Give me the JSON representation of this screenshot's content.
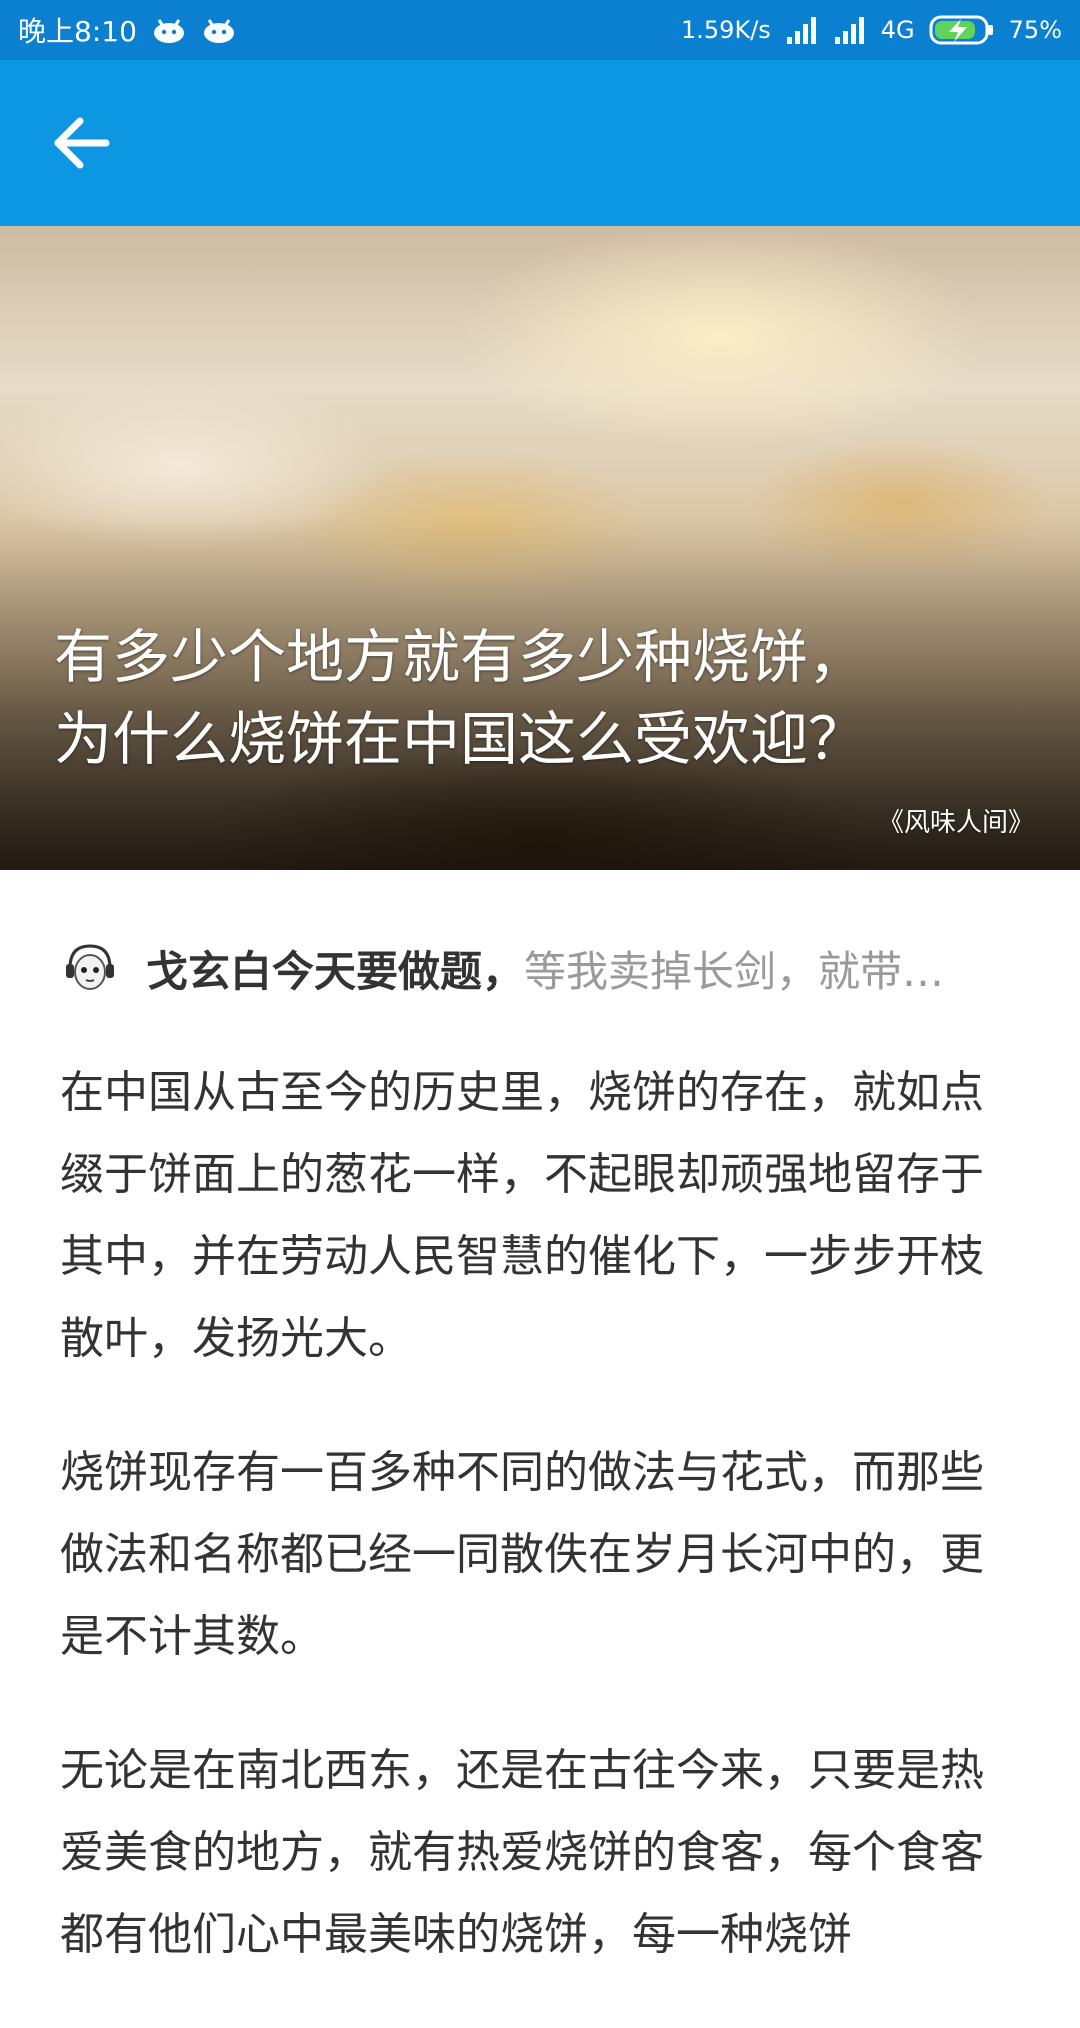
{
  "status_bar": {
    "time": "晚上8:10",
    "network_speed": "1.59K/s",
    "network_type": "4G",
    "battery": "75%"
  },
  "article": {
    "title_lines": [
      "有多少个地方就有多少种烧饼，",
      "为什么烧饼在中国这么受欢迎？"
    ],
    "image_source": "《风味人间》",
    "author": {
      "name": "戈玄白今天要做题",
      "bio": "等我卖掉长剑，就带…"
    },
    "paragraphs": [
      "在中国从古至今的历史里，烧饼的存在，就如点缀于饼面上的葱花一样，不起眼却顽强地留存于其中，并在劳动人民智慧的催化下，一步步开枝散叶，发扬光大。",
      "烧饼现存有一百多种不同的做法与花式，而那些做法和名称都已经一同散佚在岁月长河中的，更是不计其数。",
      "无论是在南北西东，还是在古往今来，只要是热爱美食的地方，就有热爱烧饼的食客，每个食客都有他们心中最美味的烧饼，每一种烧饼"
    ]
  },
  "colors": {
    "status_bar_bg": "#0b7fd0",
    "app_bar_bg": "#0d97e2",
    "text_primary": "#333333",
    "text_secondary": "#9a9a9a"
  },
  "icons": {
    "back": "back-arrow-icon",
    "status_left": [
      "android-bug-icon",
      "android-bug-icon"
    ],
    "status_right": [
      "signal-icon",
      "signal-icon",
      "battery-charging-icon"
    ]
  }
}
